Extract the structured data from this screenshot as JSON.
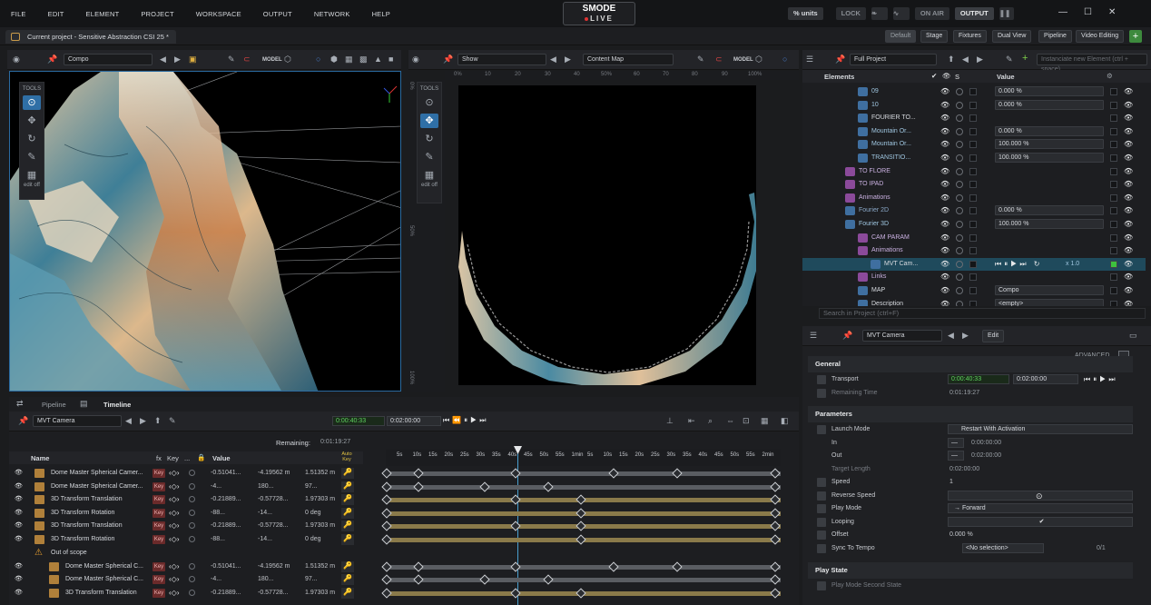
{
  "menu": {
    "items": [
      "FILE",
      "EDIT",
      "ELEMENT",
      "PROJECT",
      "WORKSPACE",
      "OUTPUT",
      "NETWORK",
      "HELP"
    ]
  },
  "brand": {
    "line1": "SMODE",
    "line2": "LIVE"
  },
  "topright": {
    "units": "% units",
    "lock": "LOCK",
    "on_air": "ON AIR",
    "output": "OUTPUT"
  },
  "project_tab": {
    "label": "Current project - Sensitive Abstraction CSI 25 *"
  },
  "workspaces": [
    "Default",
    "Stage",
    "Fixtures",
    "Dual View",
    "Pipeline",
    "Video Editing"
  ],
  "viewport_left": {
    "combo": "Compo",
    "model": "MODEL"
  },
  "viewport_right": {
    "combo": "Show",
    "map": "Content Map",
    "model": "MODEL"
  },
  "tools": {
    "title": "TOOLS",
    "edit_off": "edit off"
  },
  "ruler_top": [
    "0%",
    "10",
    "20",
    "30",
    "40",
    "50%",
    "60",
    "70",
    "80",
    "90",
    "100%"
  ],
  "ruler_left": [
    "0%",
    "50%",
    "100%"
  ],
  "tree": {
    "combo": "Full Project",
    "placeholder": "Instanciate new Element (ctrl + space)",
    "col_elements": "Elements",
    "col_value": "Value",
    "search_placeholder": "Search in Project (ctrl+F)",
    "rows": [
      {
        "name": "09",
        "value": "0.000 %"
      },
      {
        "name": "10",
        "value": "0.000 %"
      },
      {
        "name": "FOURIER TO...",
        "value": ""
      },
      {
        "name": "Mountain Or...",
        "value": "0.000 %"
      },
      {
        "name": "Mountain Or...",
        "value": "100.000 %"
      },
      {
        "name": "TRANSITIO...",
        "value": "100.000 %"
      },
      {
        "name": "TO FLORE",
        "value": ""
      },
      {
        "name": "TO IPAD",
        "value": ""
      },
      {
        "name": "Animations",
        "value": ""
      },
      {
        "name": "Fourier 2D",
        "value": "0.000 %"
      },
      {
        "name": "Fourier 3D",
        "value": "100.000 %"
      },
      {
        "name": "CAM PARAM",
        "value": ""
      },
      {
        "name": "Animations",
        "value": ""
      },
      {
        "name": "MVT Cam...",
        "value": "x 1.0"
      },
      {
        "name": "Links",
        "value": ""
      },
      {
        "name": "MAP",
        "value": "Compo"
      },
      {
        "name": "Description",
        "value": "<empty>"
      }
    ]
  },
  "inspector": {
    "title": "MVT Camera",
    "edit": "Edit",
    "advanced": "ADVANCED",
    "general": "General",
    "transport_label": "Transport",
    "transport_time": "0:00:40:33",
    "transport_total": "0:02:00:00",
    "remaining_label": "Remaining Time",
    "remaining_value": "0:01:19:27",
    "parameters": "Parameters",
    "launch_mode_label": "Launch Mode",
    "launch_mode": "Restart With Activation",
    "in_label": "In",
    "in_value": "0:00:00:00",
    "out_label": "Out",
    "out_value": "0:02:00:00",
    "target_label": "Target Length",
    "target_value": "0:02:00:00",
    "speed_label": "Speed",
    "speed_value": "1",
    "reverse_label": "Reverse Speed",
    "playmode_label": "Play Mode",
    "playmode_value": "Forward",
    "looping_label": "Looping",
    "offset_label": "Offset",
    "offset_value": "0.000 %",
    "sync_label": "Sync To Tempo",
    "sync_value": "<No selection>",
    "sync_count": "0/1",
    "playstate": "Play State",
    "playmode_second": "Play Mode Second State"
  },
  "timeline": {
    "tab_pipeline": "Pipeline",
    "tab_timeline": "Timeline",
    "combo": "MVT Camera",
    "time": "0:00:40:33",
    "total": "0:02:00:00",
    "remaining_label": "Remaining:",
    "remaining_value": "0:01:19:27",
    "col_name": "Name",
    "col_fx": "fx",
    "col_key": "Key",
    "col_dots": "...",
    "col_value": "Value",
    "col_autokey": "Auto Key",
    "ticks": [
      "5s",
      "10s",
      "15s",
      "20s",
      "25s",
      "30s",
      "35s",
      "40s",
      "45s",
      "50s",
      "55s",
      "1min",
      "5s",
      "10s",
      "15s",
      "20s",
      "25s",
      "30s",
      "35s",
      "40s",
      "45s",
      "50s",
      "55s",
      "2min"
    ],
    "out_of_scope": "Out of scope",
    "rows": [
      {
        "name": "Dome Master Spherical Camer...",
        "v1": "-0.51041...",
        "v2": "-4.19562 m",
        "v3": "1.51352 m"
      },
      {
        "name": "Dome Master Spherical Camer...",
        "v1": "-4...",
        "v2": "180...",
        "v3": "97..."
      },
      {
        "name": "3D Transform Translation",
        "v1": "-0.21889...",
        "v2": "-0.57728...",
        "v3": "1.97303 m"
      },
      {
        "name": "3D Transform Rotation",
        "v1": "-88...",
        "v2": "-14...",
        "v3": "0 deg"
      },
      {
        "name": "3D Transform Translation",
        "v1": "-0.21889...",
        "v2": "-0.57728...",
        "v3": "1.97303 m"
      },
      {
        "name": "3D Transform Rotation",
        "v1": "-88...",
        "v2": "-14...",
        "v3": "0 deg"
      },
      {
        "name": "Dome Master Spherical C...",
        "v1": "-0.51041...",
        "v2": "-4.19562 m",
        "v3": "1.51352 m"
      },
      {
        "name": "Dome Master Spherical C...",
        "v1": "-4...",
        "v2": "180...",
        "v3": "97..."
      },
      {
        "name": "3D Transform Translation",
        "v1": "-0.21889...",
        "v2": "-0.57728...",
        "v3": "1.97303 m"
      }
    ],
    "key_label": "Key"
  }
}
